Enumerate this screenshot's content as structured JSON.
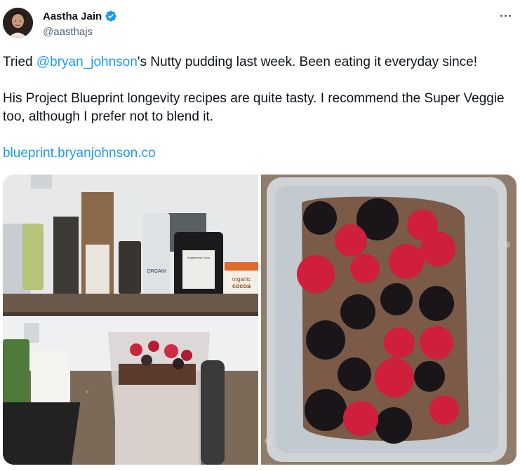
{
  "author": {
    "display_name": "Aastha Jain",
    "handle": "@aasthajs",
    "verified_icon": "verified-badge-icon",
    "avatar_icon": "avatar"
  },
  "tweet": {
    "line1_prefix": "Tried ",
    "mention": "@bryan_johnson",
    "line1_suffix": "'s Nutty pudding last week. Been eating it everyday since!",
    "line2": "His Project Blueprint longevity recipes are quite tasty. I recommend the Super Veggie too, although I prefer not to blend it.",
    "link": "blueprint.bryanjohnson.co"
  },
  "media": {
    "photo1_labels": {
      "cocoa_brand": "organic",
      "cocoa_name": "cocoa",
      "tub_label": "Supplement Facts",
      "bag_text": "ORGANI"
    }
  },
  "colors": {
    "link": "#1d9bf0",
    "verified": "#1d9bf0",
    "secondary_text": "#536471"
  },
  "more_icon": "more-options-icon"
}
